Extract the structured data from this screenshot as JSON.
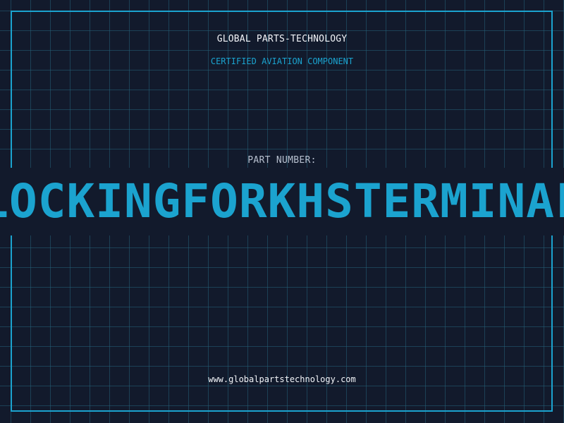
{
  "header": {
    "company": "GLOBAL PARTS-TECHNOLOGY",
    "subtitle": "CERTIFIED AVIATION COMPONENT"
  },
  "part": {
    "label": "PART NUMBER:",
    "number": "LOCKINGFORKHSTERMINAL"
  },
  "footer": {
    "url": "www.globalpartstechnology.com"
  },
  "colors": {
    "background": "#121a2c",
    "accent": "#1ba3cf",
    "grid": "#246078",
    "text": "#f2f4f8",
    "muted": "#b7c0cf"
  }
}
